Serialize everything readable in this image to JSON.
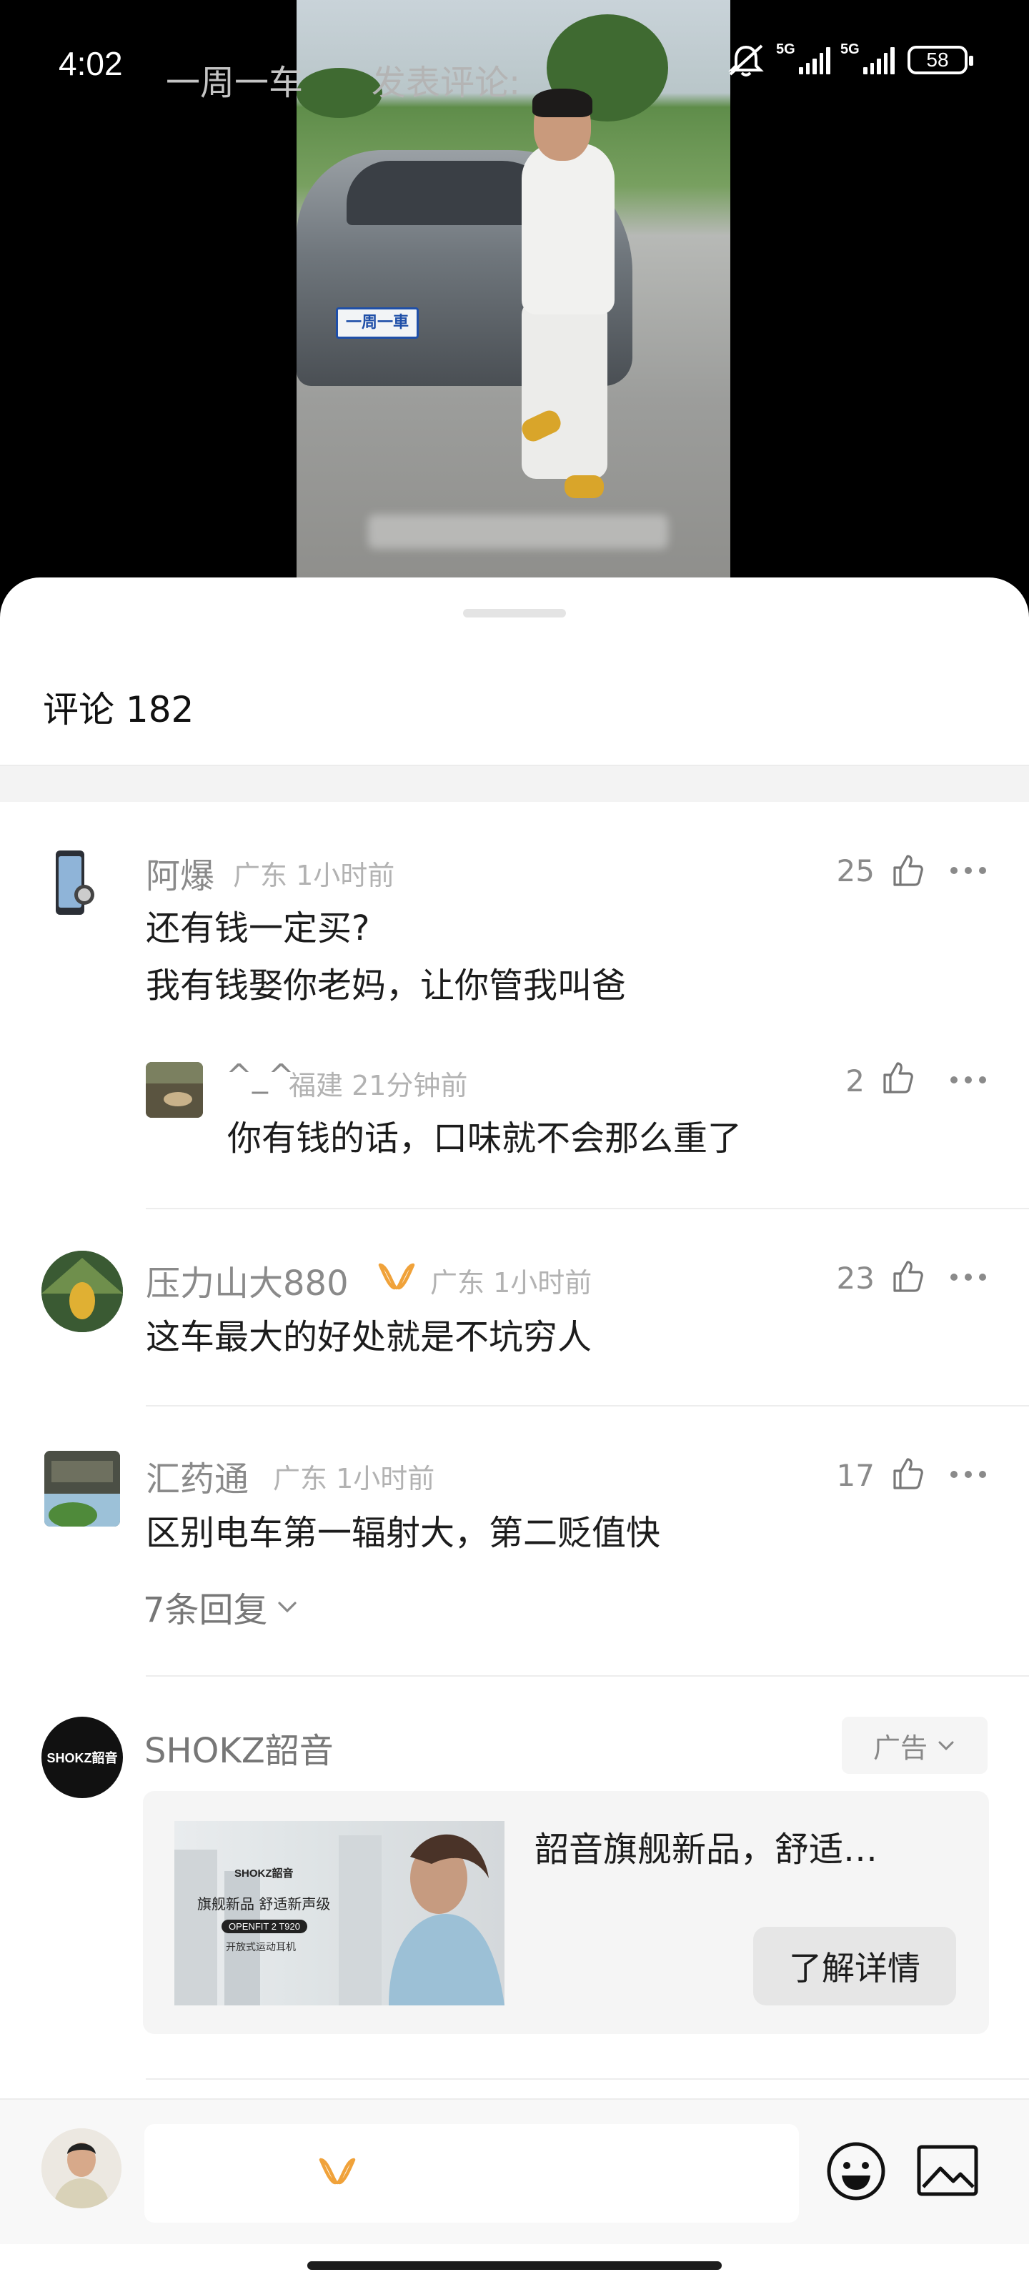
{
  "status_bar": {
    "time": "4:02",
    "network_1": "5G",
    "network_2": "5G",
    "battery": "58",
    "icons": [
      "mute-icon",
      "signal-icon",
      "signal-icon",
      "battery-icon"
    ]
  },
  "video": {
    "plate_text": "一周一車"
  },
  "sheet": {
    "title": "评论 182"
  },
  "comments": [
    {
      "username": "阿爆",
      "meta": "广东 1小时前",
      "likes": "25",
      "lines": [
        "还有钱一定买?",
        "我有钱娶你老妈，让你管我叫爸"
      ],
      "replies": [
        {
          "username": "^_^",
          "meta": "福建 21分钟前",
          "likes": "2",
          "text": "你有钱的话，口味就不会那么重了"
        }
      ]
    },
    {
      "username": "压力山大880",
      "meta": "广东 1小时前",
      "likes": "23",
      "text": "这车最大的好处就是不坑穷人"
    },
    {
      "username": "汇药通",
      "meta": "广东 1小时前",
      "likes": "17",
      "text": "区别电车第一辐射大，第二贬值快",
      "reply_count": "7条回复"
    }
  ],
  "ad": {
    "advertiser": "SHOKZ韶音",
    "logo_text": "SHOKZ韶音",
    "tag": "广告",
    "title": "韶音旗舰新品，舒适…",
    "cta": "了解详情",
    "image_brand": "SHOKZ韶音",
    "image_headline": "旗舰新品 舒适新声级",
    "image_model": "OPENFIT 2 T920",
    "image_sub": "开放式运动耳机"
  },
  "input_bar": {
    "user_name": "一周一车",
    "placeholder": "发表评论:"
  },
  "colors": {
    "vip_badge": "#f0a23a",
    "text_primary": "#1c1c1c",
    "text_secondary": "#8a8a8a"
  }
}
